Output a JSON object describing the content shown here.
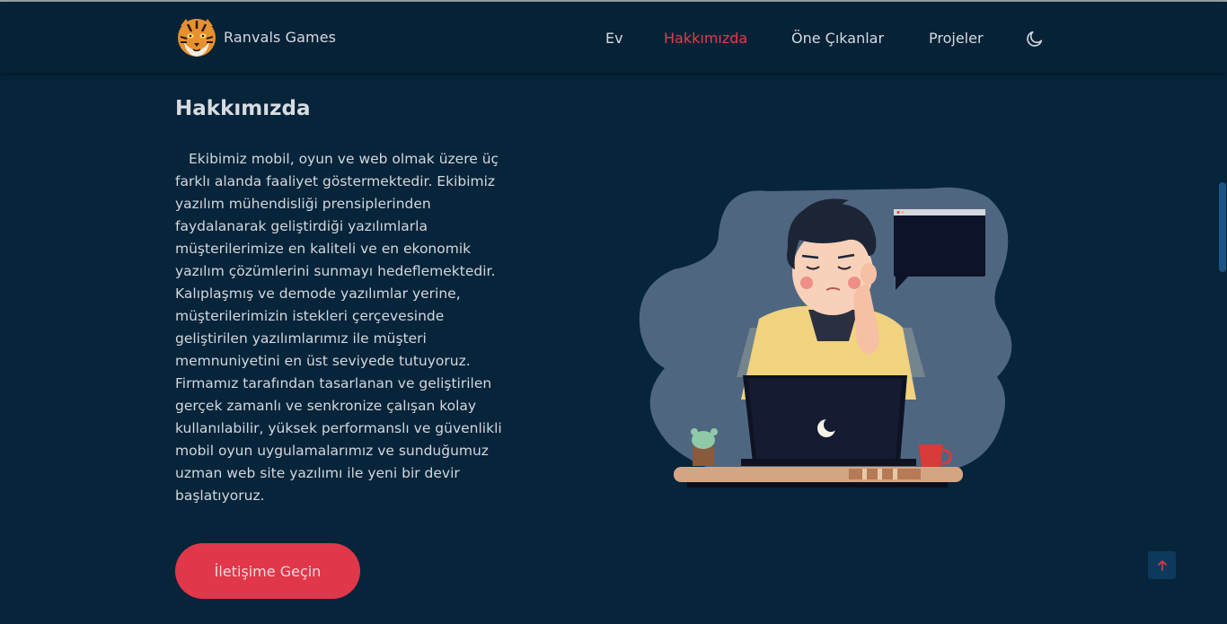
{
  "brand": {
    "name": "Ranvals Games",
    "logo_icon": "tiger-logo-icon"
  },
  "nav": {
    "items": [
      {
        "label": "Ev",
        "active": false
      },
      {
        "label": "Hakkımızda",
        "active": true
      },
      {
        "label": "Öne Çıkanlar",
        "active": false
      },
      {
        "label": "Projeler",
        "active": false
      }
    ],
    "theme_icon": "moon-icon"
  },
  "about": {
    "title": "Hakkımızda",
    "text": "Ekibimiz mobil, oyun ve web olmak üzere üç farklı alanda faaliyet göstermektedir. Ekibimiz yazılım mühendisliği prensiplerinden faydalanarak geliştirdiği yazılımlarla müşterilerimize en kaliteli ve en ekonomik yazılım çözümlerini sunmayı hedeflemektedir. Kalıplaşmış ve demode yazılımlar yerine, müşterilerimizin istekleri çerçevesinde geliştirilen yazılımlarımız ile müşteri memnuniyetini en üst seviyede tutuyoruz. Firmamız tarafından tasarlanan ve geliştirilen gerçek zamanlı ve senkronize çalışan kolay kullanılabilir, yüksek performanslı ve güvenlikli mobil oyun uygulamalarımız ve sunduğumuz uzman web site yazılımı ile yeni bir devir başlatıyoruz.",
    "cta_label": "İletişime Geçin"
  },
  "colors": {
    "background": "#06243a",
    "navbar": "#062237",
    "accent": "#e0374a"
  },
  "icons": {
    "illustration": "developer-at-laptop-illustration",
    "back_to_top": "arrow-up-icon"
  }
}
